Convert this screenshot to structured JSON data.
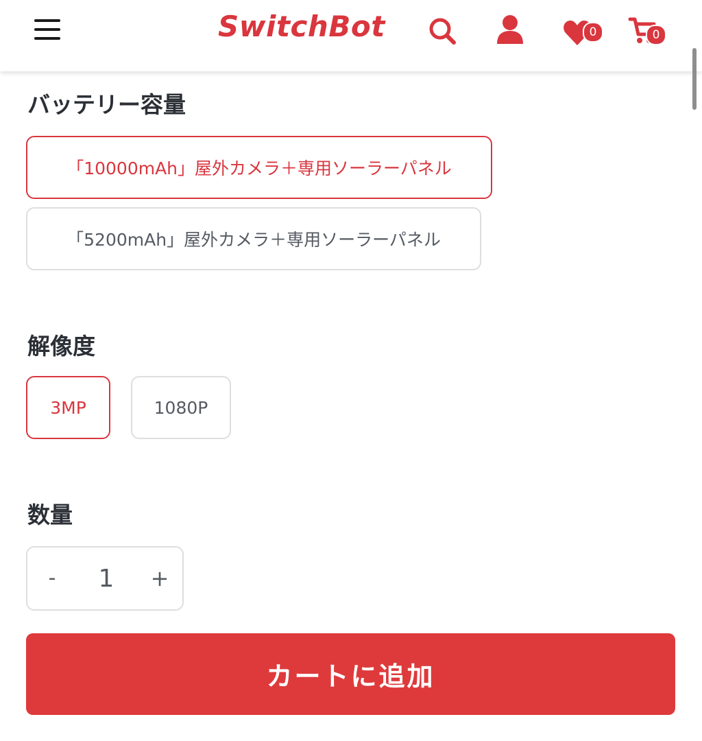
{
  "header": {
    "logo": "SwitchBot",
    "wishlist_count": "0",
    "cart_count": "0",
    "icons": [
      "menu-icon",
      "search-icon",
      "account-icon",
      "heart-icon",
      "cart-icon"
    ]
  },
  "battery": {
    "title": "バッテリー容量",
    "options": [
      {
        "label": "「10000mAh」屋外カメラ＋専用ソーラーパネル",
        "selected": true
      },
      {
        "label": "「5200mAh」屋外カメラ＋専用ソーラーパネル",
        "selected": false
      }
    ]
  },
  "resolution": {
    "title": "解像度",
    "options": [
      {
        "label": "3MP",
        "selected": true
      },
      {
        "label": "1080P",
        "selected": false
      }
    ]
  },
  "quantity": {
    "title": "数量",
    "minus": "-",
    "value": "1",
    "plus": "+"
  },
  "add_to_cart": "カートに追加",
  "colors": {
    "brand": "#d9363e",
    "button": "#de3a3c",
    "border": "#dedede",
    "text": "#2b2f36"
  }
}
